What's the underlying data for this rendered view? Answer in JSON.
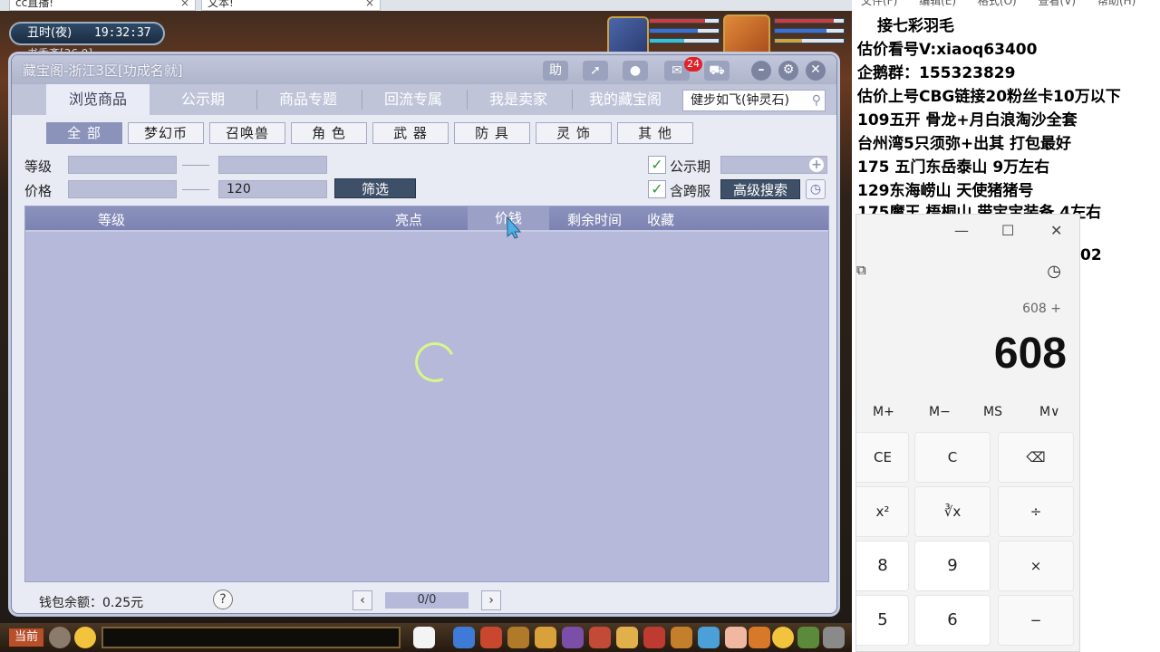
{
  "browser": {
    "tabs": [
      {
        "label": "cc直播!",
        "close": "×"
      },
      {
        "label": "文本!",
        "close": "×"
      }
    ]
  },
  "game": {
    "time_period": "丑时(夜)",
    "time": "19:32:37",
    "location": "书香斋[36,9]",
    "current_channel": "当前"
  },
  "window": {
    "title": "藏宝阁-浙江3区[功成名就]",
    "help_btn": "助",
    "message_badge": "24",
    "nav_tabs": [
      "浏览商品",
      "公示期",
      "商品专题",
      "回流专属",
      "我是卖家",
      "我的藏宝阁"
    ],
    "search_value": "健步如飞(钟灵石)",
    "categories": [
      "全 部",
      "梦幻币",
      "召唤兽",
      "角 色",
      "武 器",
      "防 具",
      "灵 饰",
      "其 他"
    ],
    "filters": {
      "level_label": "等级",
      "price_label": "价格",
      "level_min": "",
      "level_max": "",
      "price_min": "",
      "price_max": "120",
      "filter_btn": "筛选",
      "publicity_label": "公示期",
      "cross_server_label": "含跨服",
      "advanced_search_btn": "高级搜索"
    },
    "table_headers": [
      "等级",
      "亮点",
      "价钱",
      "剩余时间",
      "收藏"
    ],
    "footer": {
      "wallet": "钱包余额：0.25元",
      "help": "?",
      "prev": "‹",
      "next": "›",
      "page_info": "0/0"
    }
  },
  "notes": {
    "menu": [
      "文件(F)",
      "编辑(E)",
      "格式(O)",
      "查看(V)",
      "帮助(H)"
    ],
    "lines": [
      "接七彩羽毛",
      "估价看号V:xiaoq63400",
      "企鹅群：155323829",
      "估价上号CBG链接20粉丝卡10万以下",
      "109五开 骨龙+月白浪淘沙全套",
      "台州湾5只须弥+出其 打包最好",
      "175 五门东岳泰山  9万左右",
      "129东海崂山 天使猪猪号",
      "175魔王 梧桐山 带宝宝装备 4左右"
    ],
    "peek_text": "02"
  },
  "calculator": {
    "minimize": "—",
    "maximize": "☐",
    "close": "✕",
    "expression": "608 +",
    "display": "608",
    "memory_keys": [
      "M+",
      "M−",
      "MS",
      "M∨"
    ],
    "keys_row1": [
      "CE",
      "C",
      "⌫"
    ],
    "keys_row2": [
      "x²",
      "∛x",
      "÷"
    ],
    "keys_row3": [
      "8",
      "9",
      "×"
    ],
    "keys_row4": [
      "5",
      "6",
      "−"
    ]
  },
  "colors": {
    "window_bg": "#e8ebf3",
    "nav_bg": "#bfc4d9",
    "table_bg": "#b6b9d9",
    "table_header": "#7c83b2",
    "category_active": "#8b93bb",
    "badge": "#e0212a",
    "spinner": "#d7f78a"
  }
}
